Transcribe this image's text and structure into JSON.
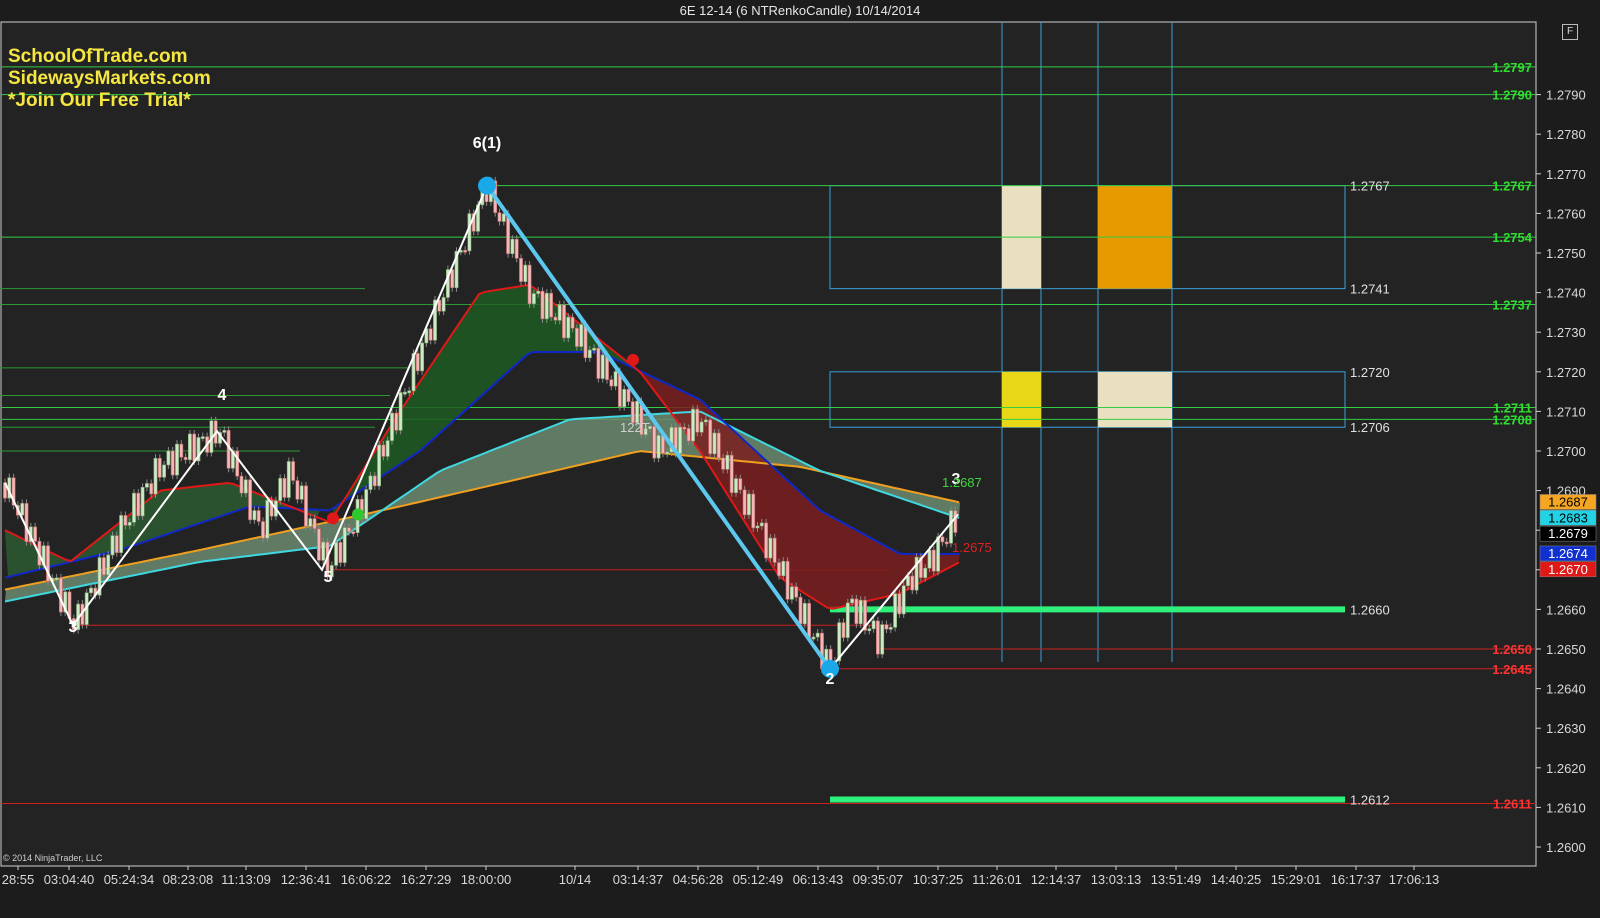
{
  "window_title": "6E 12-14 (6 NTRenkoCandle)  10/14/2014",
  "promo": {
    "line1": "SchoolOfTrade.com",
    "line2": "SidewaysMarkets.com",
    "line3": "*Join Our Free Trial*"
  },
  "copyright": "© 2014 NinjaTrader, LLC",
  "f_button": "F",
  "chart_data": {
    "type": "candlestick",
    "instrument": "6E 12-14",
    "bar_type": "6 NTRenkoCandle",
    "date": "10/14/2014",
    "ylim": [
      1.2595,
      1.28
    ],
    "y_ticks": [
      "1.2600",
      "1.2610",
      "1.2620",
      "1.2630",
      "1.2640",
      "1.2650",
      "1.2660",
      "1.2670",
      "1.2680",
      "1.2690",
      "1.2700",
      "1.2710",
      "1.2720",
      "1.2730",
      "1.2740",
      "1.2750",
      "1.2760",
      "1.2770",
      "1.2780",
      "1.2790"
    ],
    "x_ticks": [
      "28:55",
      "03:04:40",
      "05:24:34",
      "08:23:08",
      "11:13:09",
      "12:36:41",
      "16:06:22",
      "16:27:29",
      "18:00:00",
      "10/14",
      "03:14:37",
      "04:56:28",
      "05:12:49",
      "06:13:43",
      "09:35:07",
      "10:37:25",
      "11:26:01",
      "12:14:37",
      "13:03:13",
      "13:51:49",
      "14:40:25",
      "15:29:01",
      "16:17:37",
      "17:06:13"
    ],
    "swing_points": [
      {
        "label": "3",
        "price": 1.2656
      },
      {
        "label": "4",
        "price": 1.2705
      },
      {
        "label": "5",
        "price": 1.267
      },
      {
        "label": "6(1)",
        "price": 1.2767
      },
      {
        "label": "2",
        "price": 1.2645
      },
      {
        "label": "3",
        "price": 1.2684
      }
    ],
    "right_axis_labels": [
      {
        "text": "1.2797",
        "color": "#2ee02e",
        "price": 1.2797
      },
      {
        "text": "1.2790",
        "color": "#2ee02e",
        "price": 1.279
      },
      {
        "text": "1.2767",
        "color": "#2ee02e",
        "price": 1.2767
      },
      {
        "text": "1.2754",
        "color": "#2ee02e",
        "price": 1.2754
      },
      {
        "text": "1.2737",
        "color": "#2ee02e",
        "price": 1.2737
      },
      {
        "text": "1.2711",
        "color": "#2ee02e",
        "price": 1.2711
      },
      {
        "text": "1.2708",
        "color": "#2ee02e",
        "price": 1.2708
      },
      {
        "text": "1.2650",
        "color": "#ff3333",
        "price": 1.265
      },
      {
        "text": "1.2645",
        "color": "#ff3333",
        "price": 1.2645
      },
      {
        "text": "1.2611",
        "color": "#ff3333",
        "price": 1.2611
      }
    ],
    "price_badges": [
      {
        "text": "1.2687",
        "bg": "#f5a623",
        "fg": "#000000",
        "price": 1.2687
      },
      {
        "text": "1.2683",
        "bg": "#22d3e6",
        "fg": "#000000",
        "price": 1.2683
      },
      {
        "text": "1.2679",
        "bg": "#000000",
        "fg": "#ffffff",
        "price": 1.2679
      },
      {
        "text": "1.2674",
        "bg": "#1030d0",
        "fg": "#ffffff",
        "price": 1.2674
      },
      {
        "text": "1.2670",
        "bg": "#e01818",
        "fg": "#ffffff",
        "price": 1.267
      }
    ],
    "zone_labels": [
      {
        "text": "1.2767",
        "price": 1.2767
      },
      {
        "text": "1.2741",
        "price": 1.2741
      },
      {
        "text": "1.2720",
        "price": 1.272
      },
      {
        "text": "1.2706",
        "price": 1.2706
      },
      {
        "text": "1.2660",
        "price": 1.266
      },
      {
        "text": "1.2612",
        "price": 1.2612
      }
    ],
    "annotations": [
      {
        "text": "122T",
        "color": "#cfcfcf"
      },
      {
        "text": "1.2687",
        "color": "#3ed63e"
      },
      {
        "text": "1.2675",
        "color": "#e02020"
      }
    ]
  }
}
